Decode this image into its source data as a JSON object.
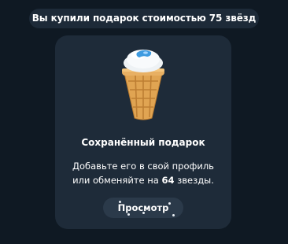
{
  "service_message": {
    "text": "Вы купили подарок стоимостью 75 звёзд"
  },
  "gift": {
    "image_icon": "ice-cream-cone-icon",
    "title": "Сохранённый подарок",
    "description_line1": "Добавьте его в свой профиль",
    "description_line2_prefix": "или обменяйте на ",
    "description_line2_count": "64",
    "description_line2_suffix": " звезды.",
    "button_label": "Просмотр"
  },
  "colors": {
    "background": "#0f1923",
    "pill": "#1d2a38",
    "card": "#1e2b39",
    "button": "#2b3a4a",
    "text": "#ffffff"
  }
}
